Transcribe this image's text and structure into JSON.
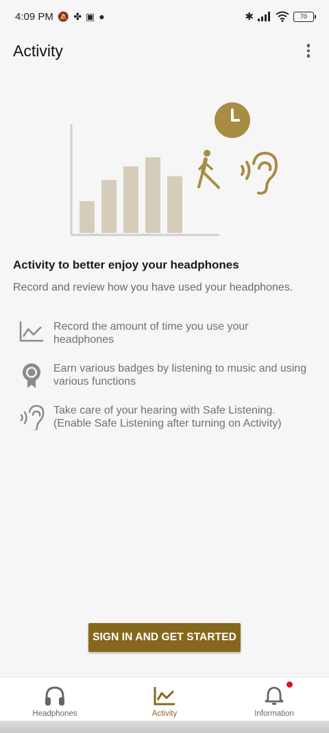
{
  "status_bar": {
    "time": "4:09 PM",
    "battery": "70"
  },
  "app_bar": {
    "title": "Activity"
  },
  "intro": {
    "title": "Activity to better enjoy your headphones",
    "description": "Record and review how you have used your headphones."
  },
  "features": [
    {
      "icon": "activity-chart-icon",
      "text_line1": "Record the amount of time you use your",
      "text_line2": "headphones"
    },
    {
      "icon": "badge-medal-icon",
      "text_line1": "Earn various badges by listening to music and using",
      "text_line2": "various functions"
    },
    {
      "icon": "ear-sound-icon",
      "text_line1": "Take care of your hearing with Safe Listening.",
      "text_line2": "(Enable Safe Listening after turning on Activity)"
    }
  ],
  "illustration": {
    "bar_levels": [
      0.42,
      0.7,
      0.88,
      1.0,
      0.75
    ],
    "colors": {
      "bars": "#d5cdb9",
      "axis": "#cfcfcf",
      "accent": "#a98c43"
    }
  },
  "actions": {
    "signin_label": "SIGN IN AND GET STARTED"
  },
  "bottom_nav": {
    "items": [
      {
        "label": "Headphones",
        "icon": "headphones-icon",
        "active": false
      },
      {
        "label": "Activity",
        "icon": "activity-chart-icon",
        "active": true
      },
      {
        "label": "Information",
        "icon": "bell-icon",
        "active": false,
        "has_notification": true
      }
    ]
  },
  "colors": {
    "accent": "#86681c",
    "notification": "#e3101d",
    "background": "#f6f6f6"
  }
}
